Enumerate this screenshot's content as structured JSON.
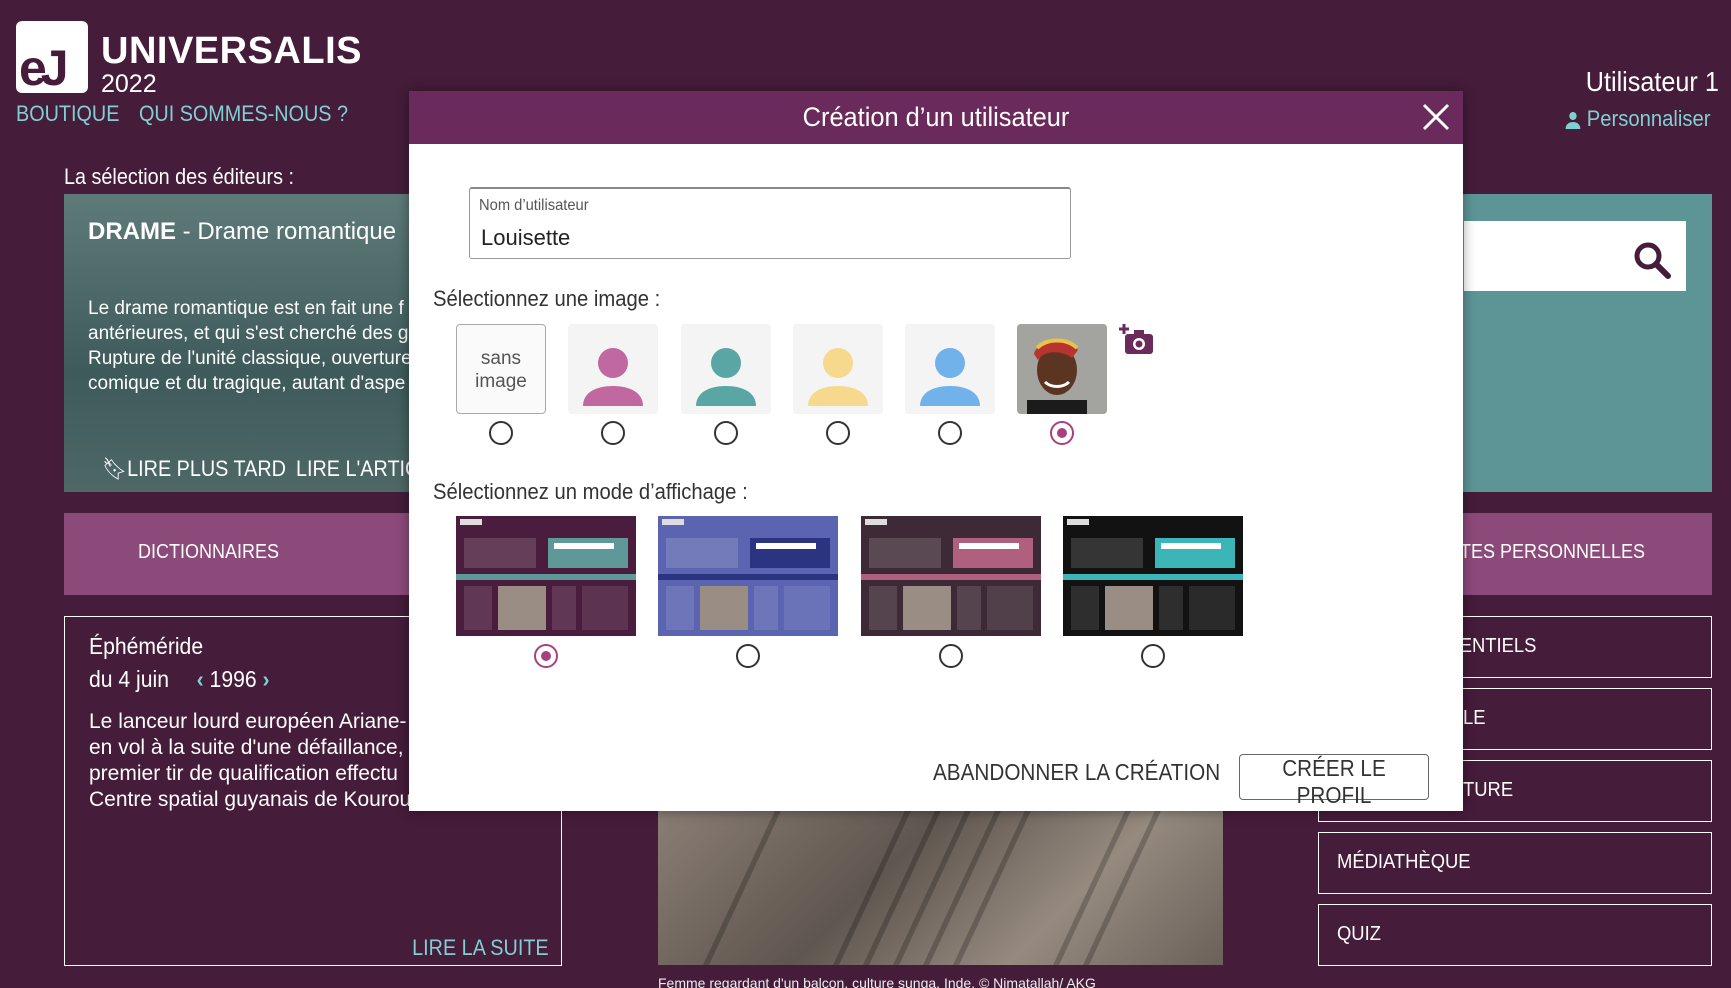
{
  "header": {
    "logo_text": "eJ",
    "brand": "UNIVERSALIS",
    "year": "2022",
    "links": [
      "BOUTIQUE",
      "QUI SOMMES-NOUS ?"
    ],
    "user_name": "Utilisateur 1",
    "personalize": "Personnaliser"
  },
  "selection": {
    "title": "La sélection des éditeurs :",
    "feature_category": "DRAME",
    "feature_sep": " - ",
    "feature_subtitle": "Drame romantique",
    "feature_lines": [
      "Le drame romantique est en fait une f",
      "antérieures, et qui s'est cherché des g",
      "Rupture de l'unité classique, ouverture",
      "comique et du tragique, autant d'aspe"
    ],
    "read_later": "LIRE PLUS TARD",
    "read_article": "LIRE L'ARTIC"
  },
  "bands": {
    "left": "DICTIONNAIRES",
    "right": "TES PERSONNELLES"
  },
  "ephemeride": {
    "title": "Éphéméride",
    "date_prefix": "du 4  juin",
    "year": "1996",
    "lines": [
      "Le lanceur lourd européen Ariane-",
      "en vol à la suite d'une défaillance,",
      "premier tir de qualification effectu",
      "Centre spatial guyanais de Kourou"
    ],
    "more": "LIRE LA SUITE"
  },
  "photo_caption": "Femme regardant d'un balcon, culture sunga, Inde.  © Nimatallah/ AKG",
  "right_menu": [
    "IEMENTIELS",
    "LE",
    "TURE",
    "MÉDIATHÈQUE",
    "QUIZ"
  ],
  "modal": {
    "title": "Création d’un utilisateur",
    "name_label": "Nom d’utilisateur",
    "name_value": "Louisette",
    "image_label": "Sélectionnez une image :",
    "no_image_line1": "sans",
    "no_image_line2": "image",
    "avatar_colors": [
      "#c0689f",
      "#5aa6a4",
      "#f7d98d",
      "#72b2ea"
    ],
    "selected_image_index": 5,
    "mode_label": "Sélectionnez un mode d’affichage :",
    "selected_mode_index": 0,
    "themes": [
      {
        "bg": "#4a1d3e",
        "accent": "#5f9899"
      },
      {
        "bg": "#5b64b0",
        "accent": "#2b3480"
      },
      {
        "bg": "#3e2a36",
        "accent": "#b0607f"
      },
      {
        "bg": "#121212",
        "accent": "#3bb5b8"
      }
    ],
    "cancel_label": "ABANDONNER LA CRÉATION",
    "create_label": "CRÉER LE PROFIL"
  }
}
